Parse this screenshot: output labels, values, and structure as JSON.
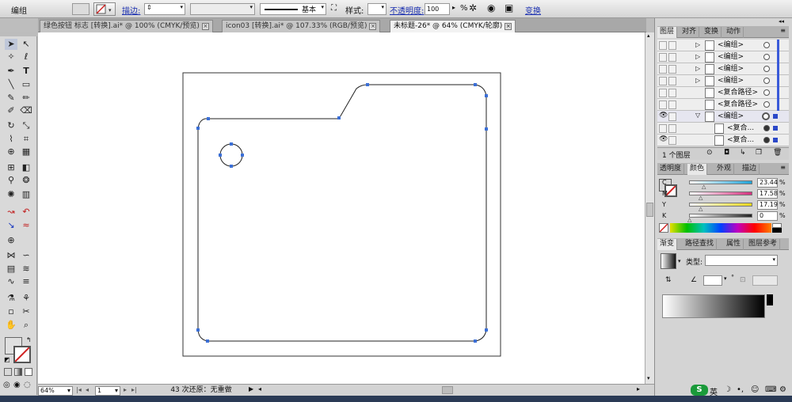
{
  "toolbar": {
    "selection_label": "编组",
    "stroke_label": "描边:",
    "stroke_profile_label": "基本",
    "style_label": "样式:",
    "opacity_label": "不透明度:",
    "opacity_value": "100",
    "opacity_unit": "%",
    "transform_label": "变换"
  },
  "tabs": [
    {
      "label": "绿色按钮 标志 [转换].ai* @ 100% (CMYK/预览)",
      "active": false
    },
    {
      "label": "icon03 [转换].ai* @ 107.33% (RGB/预览)",
      "active": false
    },
    {
      "label": "未标题-26* @ 64% (CMYK/轮廓)",
      "active": true
    }
  ],
  "status": {
    "zoom": "64%",
    "page": "1",
    "history": "43 次还原：无重做"
  },
  "layers_panel": {
    "tabs": [
      "图层",
      "对齐",
      "变换",
      "动作"
    ],
    "rows": [
      {
        "name": "<编组>",
        "indent": 0
      },
      {
        "name": "<编组>",
        "indent": 0
      },
      {
        "name": "<编组>",
        "indent": 0
      },
      {
        "name": "<编组>",
        "indent": 0
      },
      {
        "name": "<复合路径>",
        "indent": 0
      },
      {
        "name": "<复合路径>",
        "indent": 0
      },
      {
        "name": "<编组>",
        "indent": 0
      },
      {
        "name": "<复合...",
        "indent": 1
      },
      {
        "name": "<复合...",
        "indent": 1
      }
    ],
    "footer_count": "1 个图层"
  },
  "color_panel": {
    "tabs": [
      "透明度",
      "颜色",
      "外观",
      "描边"
    ],
    "channels": [
      {
        "label": "C",
        "value": "23.44",
        "unit": "%",
        "color": "#1fa3d8"
      },
      {
        "label": "M",
        "value": "17.58",
        "unit": "%",
        "color": "#d4307e"
      },
      {
        "label": "Y",
        "value": "17.19",
        "unit": "%",
        "color": "#e9d71a"
      },
      {
        "label": "K",
        "value": "0",
        "unit": "%",
        "color": "#222222"
      }
    ]
  },
  "gradient_panel": {
    "tabs": [
      "渐变",
      "路径查找",
      "属性",
      "图层参考"
    ],
    "type_label": "类型:"
  },
  "colors": {
    "anchor": "#3b6fd6",
    "path": "#222222"
  }
}
